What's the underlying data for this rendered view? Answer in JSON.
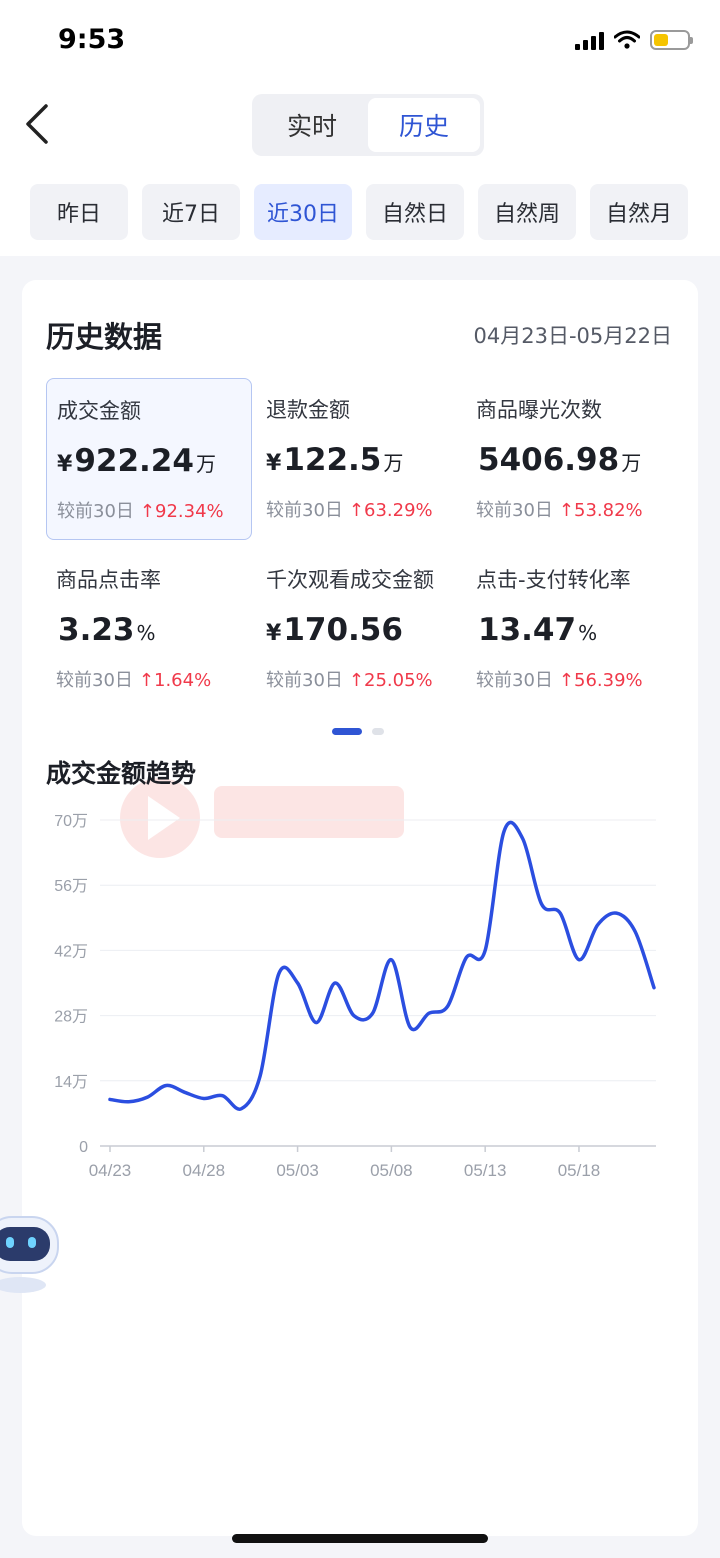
{
  "status": {
    "time": "9:53"
  },
  "nav": {
    "tabs": [
      "实时",
      "历史"
    ],
    "active_tab": "历史"
  },
  "range": {
    "items": [
      "昨日",
      "近7日",
      "近30日",
      "自然日",
      "自然周",
      "自然月"
    ],
    "active": "近30日"
  },
  "card": {
    "title": "历史数据",
    "date_range": "04月23日-05月22日"
  },
  "metrics": [
    {
      "label": "成交金额",
      "currency": "¥",
      "value": "922.24",
      "unit": "万",
      "compare_label": "较前30日",
      "change": "↑92.34%",
      "selected": true
    },
    {
      "label": "退款金额",
      "currency": "¥",
      "value": "122.5",
      "unit": "万",
      "compare_label": "较前30日",
      "change": "↑63.29%"
    },
    {
      "label": "商品曝光次数",
      "currency": "",
      "value": "5406.98",
      "unit": "万",
      "compare_label": "较前30日",
      "change": "↑53.82%"
    },
    {
      "label": "商品点击率",
      "currency": "",
      "value": "3.23",
      "unit": "%",
      "compare_label": "较前30日",
      "change": "↑1.64%"
    },
    {
      "label": "千次观看成交金额",
      "currency": "¥",
      "value": "170.56",
      "unit": "",
      "compare_label": "较前30日",
      "change": "↑25.05%"
    },
    {
      "label": "点击-支付转化率",
      "currency": "",
      "value": "13.47",
      "unit": "%",
      "compare_label": "较前30日",
      "change": "↑56.39%"
    }
  ],
  "trend": {
    "title": "成交金额趋势"
  },
  "colors": {
    "accent": "#2f55d4",
    "up": "#f0394a",
    "line": "#2b4ee0"
  },
  "chart_data": {
    "type": "line",
    "title": "成交金额趋势",
    "y_ticks": [
      "0",
      "14万",
      "28万",
      "42万",
      "56万",
      "70万"
    ],
    "ylim": [
      0,
      70
    ],
    "x_ticks": [
      "04/23",
      "04/28",
      "05/03",
      "05/08",
      "05/13",
      "05/18"
    ],
    "x": [
      "04/23",
      "04/24",
      "04/25",
      "04/26",
      "04/27",
      "04/28",
      "04/29",
      "04/30",
      "05/01",
      "05/02",
      "05/03",
      "05/04",
      "05/05",
      "05/06",
      "05/07",
      "05/08",
      "05/09",
      "05/10",
      "05/11",
      "05/12",
      "05/13",
      "05/14",
      "05/15",
      "05/16",
      "05/17",
      "05/18",
      "05/19",
      "05/20",
      "05/21",
      "05/22"
    ],
    "series": [
      {
        "values": [
          10,
          9.5,
          10.5,
          13,
          11.5,
          10.2,
          10.8,
          8,
          15,
          37,
          35,
          26.5,
          35,
          28,
          28.5,
          40,
          25.5,
          28.5,
          30,
          40.5,
          42,
          67.5,
          66,
          52,
          50,
          40,
          47.5,
          50,
          46,
          34
        ]
      }
    ],
    "grid": true
  }
}
